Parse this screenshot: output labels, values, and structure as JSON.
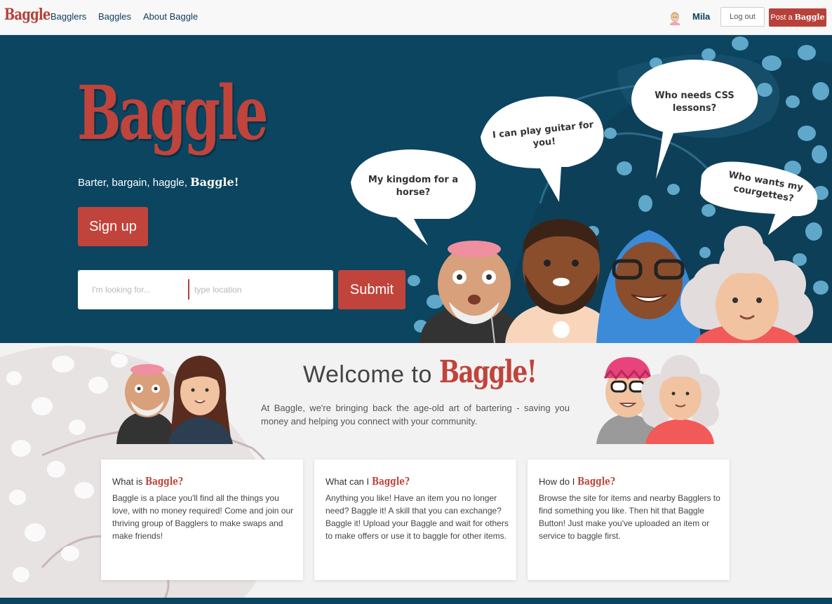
{
  "navbar": {
    "logo": "Baggle",
    "links": [
      "Bagglers",
      "Baggles",
      "About Baggle"
    ],
    "user_name": "Mila",
    "logout_label": "Log out",
    "post_prefix": "Post a",
    "post_brand": "Baggle"
  },
  "hero": {
    "logo": "Baggle",
    "tagline": "Barter, bargain, haggle,",
    "tagline_brand": "Baggle!",
    "signup_label": "Sign up",
    "search_placeholder": "I'm looking for...",
    "location_placeholder": "type location",
    "submit_label": "Submit",
    "bubbles": [
      "My kingdom for a horse?",
      "I can play guitar for you!",
      "Who needs CSS lessons?",
      "Who wants my courgettes?"
    ]
  },
  "welcome": {
    "title_prefix": "Welcome to",
    "title_brand": "Baggle!",
    "text": "At Baggle, we're bringing back the age-old art of bartering - saving you money and helping you connect with your community."
  },
  "cards": [
    {
      "title_prefix": "What is",
      "title_brand": "Baggle?",
      "body": "Baggle is a place you'll find all the things you love, with no money required! Come and join our thriving group of Bagglers to make swaps and make friends!"
    },
    {
      "title_prefix": "What can I",
      "title_brand": "Baggle?",
      "body": "Anything you like! Have an item you no longer need? Baggle it! A skill that you can exchange? Baggle it! Upload your Baggle and wait for others to make offers or use it to baggle for other items."
    },
    {
      "title_prefix": "How do I",
      "title_brand": "Baggle?",
      "body": "Browse the site for items and nearby Bagglers to find something you like. Then hit that Baggle Button! Just make you've uploaded an item or service to baggle first."
    }
  ],
  "colors": {
    "brand_red": "#c0443b",
    "hero_blue": "#0b4560",
    "blob_blue": "#5fa8c9",
    "page_bg": "#f3f2f2"
  }
}
